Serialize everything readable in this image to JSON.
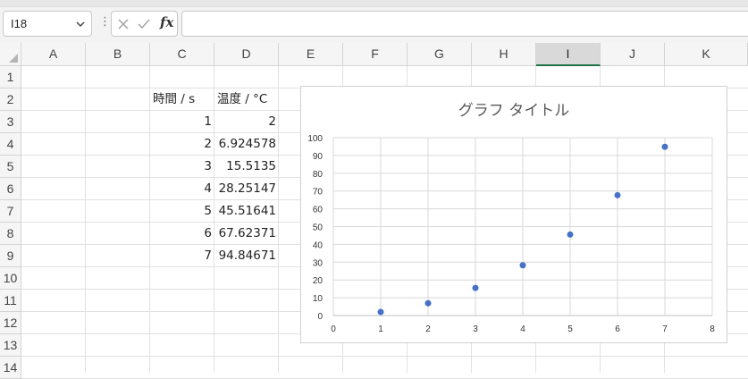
{
  "name_box": {
    "value": "I18"
  },
  "formula_bar": {
    "fx_label": "fx",
    "formula_value": ""
  },
  "columns": [
    "A",
    "B",
    "C",
    "D",
    "E",
    "F",
    "G",
    "H",
    "I",
    "J",
    "K"
  ],
  "selected_column": "I",
  "rows": [
    "1",
    "2",
    "3",
    "4",
    "5",
    "6",
    "7",
    "8",
    "9",
    "10",
    "11",
    "12",
    "13",
    "14"
  ],
  "cells": {
    "C2": "時間 / s",
    "D2": "温度 / °C",
    "C3": "1",
    "D3": "2",
    "C4": "2",
    "D4": "6.924578",
    "C5": "3",
    "D5": "15.5135",
    "C6": "4",
    "D6": "28.25147",
    "C7": "5",
    "D7": "45.51641",
    "C8": "6",
    "D8": "67.62371",
    "C9": "7",
    "D9": "94.84671"
  },
  "colors": {
    "accent": "#217346",
    "marker": "#4472C4",
    "selected_header_bg": "#d9d9d9"
  },
  "icons": [
    "chevron-down-icon",
    "more-options-icon",
    "cancel-icon",
    "enter-icon",
    "insert-function-icon"
  ],
  "chart_data": {
    "type": "scatter",
    "title": "グラフ タイトル",
    "series": [
      {
        "x": [
          1,
          2,
          3,
          4,
          5,
          6,
          7
        ],
        "y": [
          2,
          6.924578,
          15.5135,
          28.25147,
          45.51641,
          67.62371,
          94.84671
        ]
      }
    ],
    "xlim": [
      0,
      8
    ],
    "ylim": [
      0,
      100
    ],
    "x_ticks": [
      "0",
      "1",
      "2",
      "3",
      "4",
      "5",
      "6",
      "7",
      "8"
    ],
    "y_ticks": [
      "0",
      "10",
      "20",
      "30",
      "40",
      "50",
      "60",
      "70",
      "80",
      "90",
      "100"
    ],
    "grid": true,
    "legend": "none"
  }
}
